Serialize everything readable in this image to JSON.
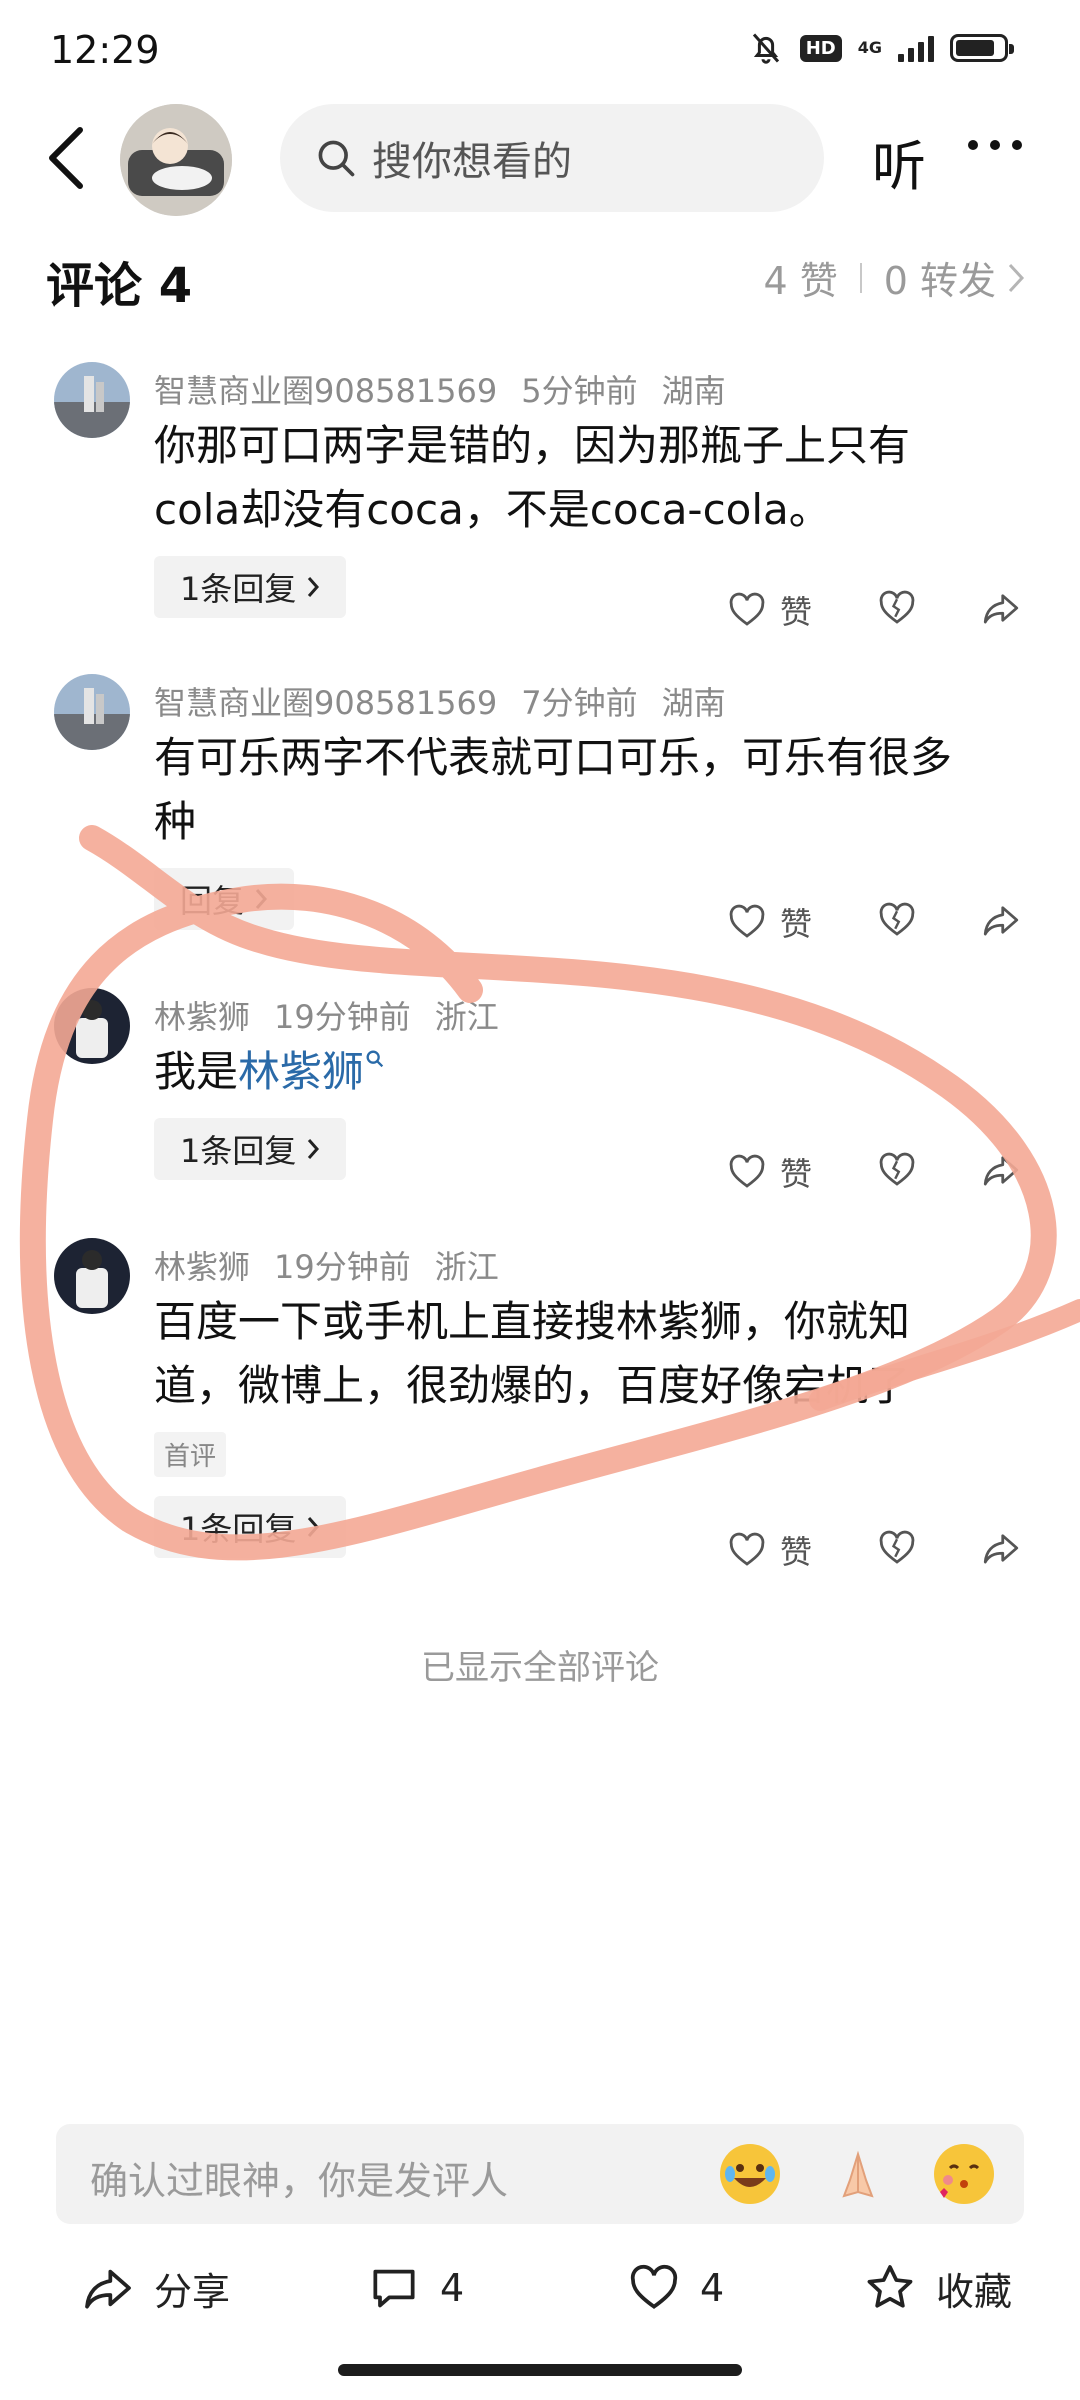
{
  "status_bar": {
    "time": "12:29",
    "network": "4G"
  },
  "header": {
    "search_placeholder": "搜你想看的",
    "listen_label": "听"
  },
  "comments_header": {
    "title": "评论 4",
    "likes": "4 赞",
    "reposts": "0 转发"
  },
  "comments": [
    {
      "user": "智慧商业圈908581569",
      "time": "5分钟前",
      "location": "湖南",
      "text_lines": [
        "你那可口两字是错的，因为那瓶子上只有",
        "cola却没有coca，不是coca-cola。"
      ],
      "reply_label": "1条回复",
      "like_label": "赞"
    },
    {
      "user": "智慧商业圈908581569",
      "time": "7分钟前",
      "location": "湖南",
      "text_lines": [
        "有可乐两字不代表就可口可乐，可乐有很多",
        "种"
      ],
      "reply_label": "回复",
      "like_label": "赞"
    },
    {
      "user": "林紫狮",
      "time": "19分钟前",
      "location": "浙江",
      "text_prefix": "我是",
      "text_link": "林紫狮",
      "reply_label": "1条回复",
      "like_label": "赞"
    },
    {
      "user": "林紫狮",
      "time": "19分钟前",
      "location": "浙江",
      "text_lines": [
        "百度一下或手机上直接搜林紫狮，你就知",
        "道，微博上，很劲爆的，百度好像宕机了"
      ],
      "tag": "首评",
      "reply_label": "1条回复",
      "like_label": "赞"
    }
  ],
  "all_shown_text": "已显示全部评论",
  "comment_input": {
    "placeholder": "确认过眼神，你是发评人"
  },
  "bottom_bar": {
    "share_label": "分享",
    "comment_count": "4",
    "like_count": "4",
    "favorite_label": "收藏"
  },
  "colors": {
    "link": "#2a6aa8",
    "scribble": "#f4a995",
    "muted_text": "#8a8a8a"
  },
  "icons": [
    "back-arrow-icon",
    "search-icon",
    "more-dots-icon",
    "like-icon",
    "dislike-icon",
    "share-icon",
    "comment-icon",
    "star-icon",
    "chevron-right-icon",
    "mute-bell-icon",
    "signal-icon",
    "battery-icon"
  ]
}
